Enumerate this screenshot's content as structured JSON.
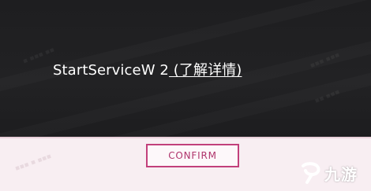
{
  "dialog": {
    "message_prefix": "StartServiceW 2",
    "learn_more_label": " (了解详情)",
    "confirm_label": "CONFIRM"
  },
  "watermark": {
    "brand_text": "九游"
  },
  "colors": {
    "dialog_background": "#1e1e20",
    "footer_background": "#f8eef2",
    "accent": "#c2407b",
    "text": "#ffffff"
  }
}
